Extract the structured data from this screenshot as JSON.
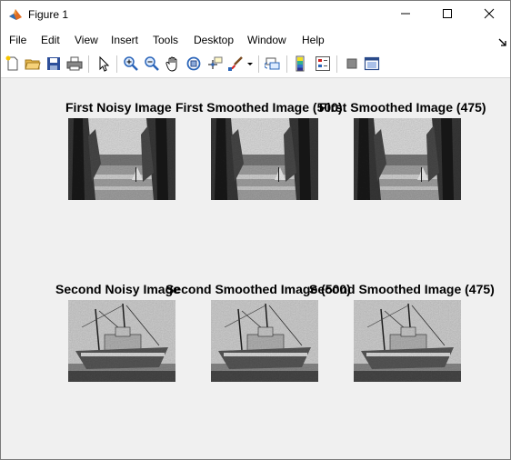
{
  "window": {
    "title": "Figure 1"
  },
  "menu": [
    "File",
    "Edit",
    "View",
    "Insert",
    "Tools",
    "Desktop",
    "Window",
    "Help"
  ],
  "toolbar": {
    "icons": [
      "new-figure-icon",
      "open-file-icon",
      "save-icon",
      "print-icon",
      "edit-plot-arrow-icon",
      "zoom-in-icon",
      "zoom-out-icon",
      "pan-hand-icon",
      "rotate-3d-icon",
      "data-cursor-icon",
      "brush-icon",
      "brush-dropdown-icon",
      "link-plot-icon",
      "insert-colorbar-icon",
      "insert-legend-icon",
      "hide-plot-tools-icon",
      "show-plot-tools-icon"
    ]
  },
  "plots": [
    {
      "title": "First Noisy Image",
      "subject": "trees-lake-scene"
    },
    {
      "title": "First Smoothed Image (500)",
      "subject": "trees-lake-scene"
    },
    {
      "title": "First Smoothed Image (475)",
      "subject": "trees-lake-scene"
    },
    {
      "title": "Second Noisy Image",
      "subject": "fishing-boat-scene"
    },
    {
      "title": "Second Smoothed Image (500)",
      "subject": "fishing-boat-scene"
    },
    {
      "title": "Second Smoothed Image (475)",
      "subject": "fishing-boat-scene"
    }
  ]
}
